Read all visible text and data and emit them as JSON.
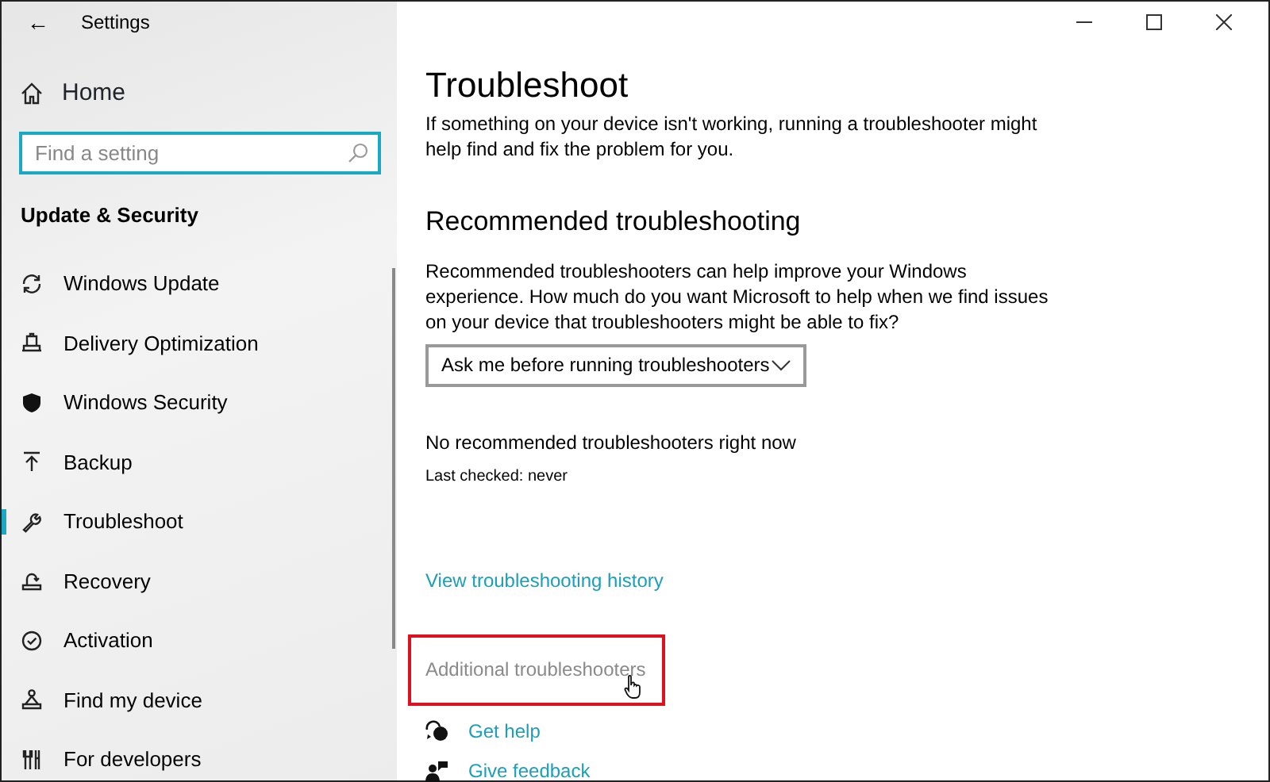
{
  "window": {
    "title": "Settings",
    "back": "←"
  },
  "sidebar": {
    "home": "Home",
    "search": {
      "placeholder": "Find a setting",
      "focused": true
    },
    "section": "Update & Security",
    "items": [
      {
        "label": "Windows Update",
        "selected": false
      },
      {
        "label": "Delivery Optimization",
        "selected": false
      },
      {
        "label": "Windows Security",
        "selected": false
      },
      {
        "label": "Backup",
        "selected": false
      },
      {
        "label": "Troubleshoot",
        "selected": true
      },
      {
        "label": "Recovery",
        "selected": false
      },
      {
        "label": "Activation",
        "selected": false
      },
      {
        "label": "Find my device",
        "selected": false
      },
      {
        "label": "For developers",
        "selected": false
      }
    ]
  },
  "main": {
    "title": "Troubleshoot",
    "intro": "If something on your device isn't working, running a troubleshooter might help find and fix the problem for you.",
    "heading": "Recommended troubleshooting",
    "description": "Recommended troubleshooters can help improve your Windows experience. How much do you want Microsoft to help when we find issues on your device that troubleshooters might be able to fix?",
    "dropdown": {
      "value": "Ask me before running troubleshooters"
    },
    "status": "No recommended troubleshooters right now",
    "last_checked": "Last checked: never",
    "links": [
      {
        "label": "View troubleshooting history",
        "hovered": false,
        "highlighted": false
      },
      {
        "label": "Additional troubleshooters",
        "hovered": true,
        "highlighted": true
      }
    ],
    "help_links": [
      {
        "label": "Get help",
        "kind": "help"
      },
      {
        "label": "Give feedback",
        "kind": "feedback"
      }
    ]
  }
}
